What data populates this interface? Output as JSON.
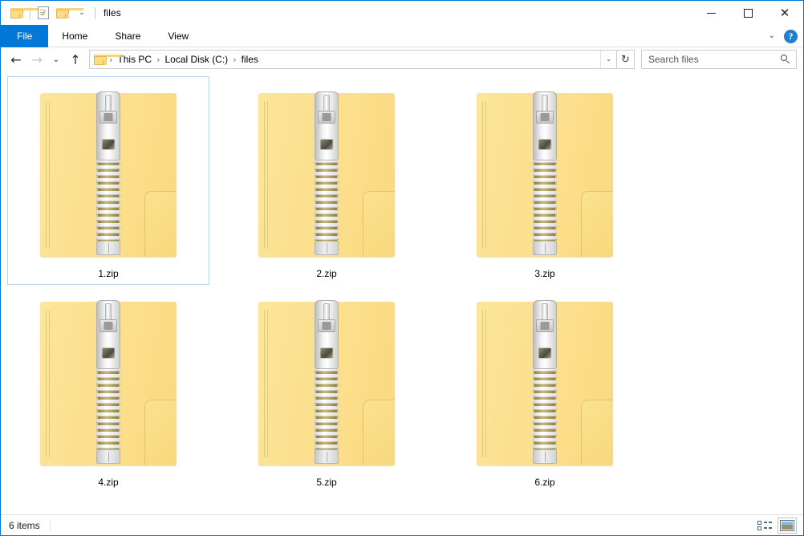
{
  "window": {
    "title": "files",
    "quick_access": [
      {
        "name": "folder-icon",
        "label": ""
      },
      {
        "name": "properties-icon",
        "label": ""
      },
      {
        "name": "new-folder-icon",
        "label": ""
      },
      {
        "name": "customize-chevron-icon",
        "label": "⌄"
      }
    ],
    "caption": {
      "minimize": "–",
      "maximize": "□",
      "close": "✕"
    }
  },
  "ribbon": {
    "tabs": [
      {
        "label": "File",
        "active": true
      },
      {
        "label": "Home",
        "active": false
      },
      {
        "label": "Share",
        "active": false
      },
      {
        "label": "View",
        "active": false
      }
    ],
    "expand_icon": "⌄",
    "help_label": "?"
  },
  "address": {
    "back_icon": "←",
    "forward_icon": "→",
    "recent_icon": "⌄",
    "up_icon": "↑",
    "breadcrumbs": [
      {
        "label": "This PC"
      },
      {
        "label": "Local Disk (C:)"
      },
      {
        "label": "files"
      }
    ],
    "separator": "›",
    "dropdown_icon": "⌄",
    "refresh_icon": "↻"
  },
  "search": {
    "placeholder": "Search files",
    "value": ""
  },
  "files": [
    {
      "name": "1.zip",
      "selected": true
    },
    {
      "name": "2.zip",
      "selected": false
    },
    {
      "name": "3.zip",
      "selected": false
    },
    {
      "name": "4.zip",
      "selected": false
    },
    {
      "name": "5.zip",
      "selected": false
    },
    {
      "name": "6.zip",
      "selected": false
    }
  ],
  "status": {
    "item_count": "6 items",
    "view_details_icon": "details-view",
    "view_thumbnails_icon": "large-icons-view"
  },
  "colors": {
    "accent": "#0078d7",
    "folder_yellow": "#fbe090",
    "selection_border": "#b3d6f0",
    "help_blue": "#1f7fd1"
  }
}
